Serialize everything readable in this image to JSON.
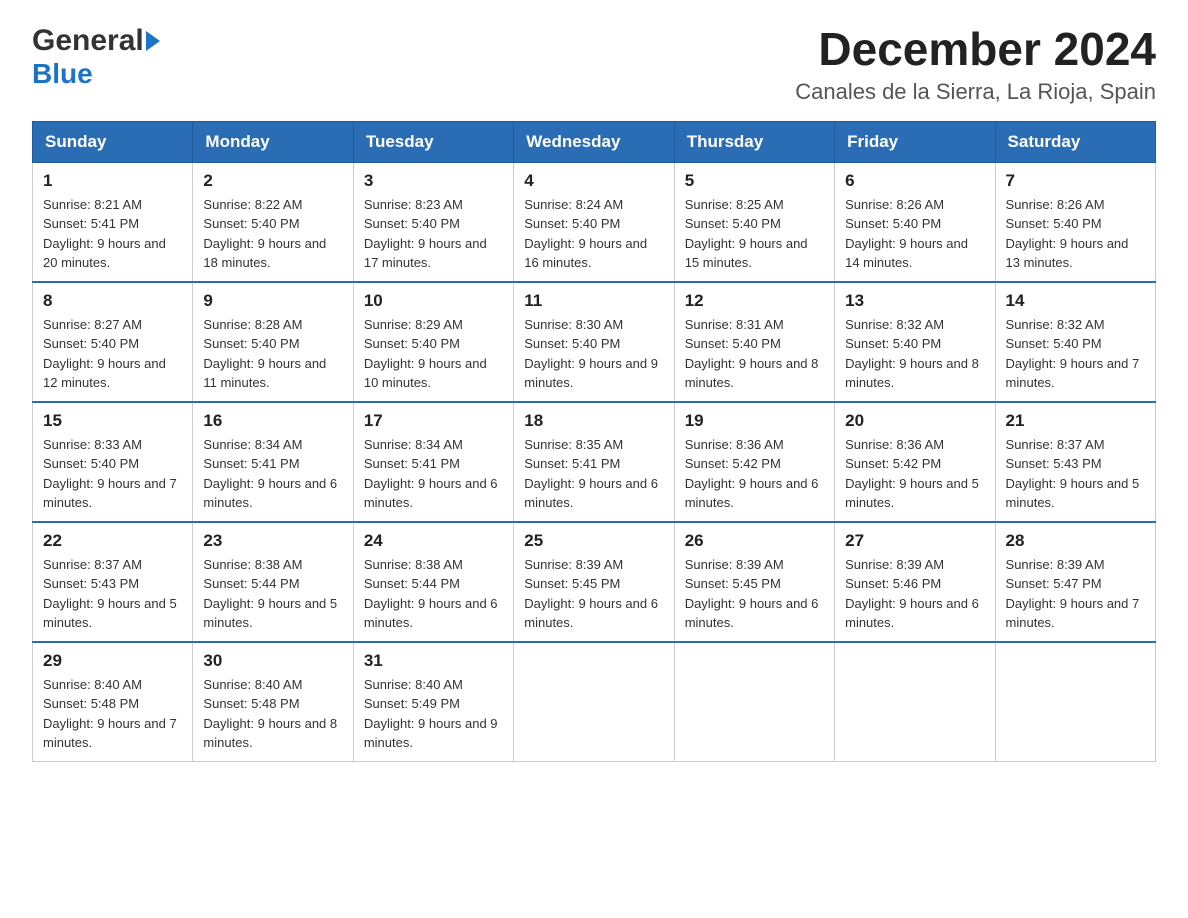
{
  "header": {
    "title": "December 2024",
    "subtitle": "Canales de la Sierra, La Rioja, Spain",
    "logo_general": "General",
    "logo_blue": "Blue"
  },
  "columns": [
    "Sunday",
    "Monday",
    "Tuesday",
    "Wednesday",
    "Thursday",
    "Friday",
    "Saturday"
  ],
  "weeks": [
    [
      {
        "day": "1",
        "sunrise": "8:21 AM",
        "sunset": "5:41 PM",
        "daylight": "9 hours and 20 minutes."
      },
      {
        "day": "2",
        "sunrise": "8:22 AM",
        "sunset": "5:40 PM",
        "daylight": "9 hours and 18 minutes."
      },
      {
        "day": "3",
        "sunrise": "8:23 AM",
        "sunset": "5:40 PM",
        "daylight": "9 hours and 17 minutes."
      },
      {
        "day": "4",
        "sunrise": "8:24 AM",
        "sunset": "5:40 PM",
        "daylight": "9 hours and 16 minutes."
      },
      {
        "day": "5",
        "sunrise": "8:25 AM",
        "sunset": "5:40 PM",
        "daylight": "9 hours and 15 minutes."
      },
      {
        "day": "6",
        "sunrise": "8:26 AM",
        "sunset": "5:40 PM",
        "daylight": "9 hours and 14 minutes."
      },
      {
        "day": "7",
        "sunrise": "8:26 AM",
        "sunset": "5:40 PM",
        "daylight": "9 hours and 13 minutes."
      }
    ],
    [
      {
        "day": "8",
        "sunrise": "8:27 AM",
        "sunset": "5:40 PM",
        "daylight": "9 hours and 12 minutes."
      },
      {
        "day": "9",
        "sunrise": "8:28 AM",
        "sunset": "5:40 PM",
        "daylight": "9 hours and 11 minutes."
      },
      {
        "day": "10",
        "sunrise": "8:29 AM",
        "sunset": "5:40 PM",
        "daylight": "9 hours and 10 minutes."
      },
      {
        "day": "11",
        "sunrise": "8:30 AM",
        "sunset": "5:40 PM",
        "daylight": "9 hours and 9 minutes."
      },
      {
        "day": "12",
        "sunrise": "8:31 AM",
        "sunset": "5:40 PM",
        "daylight": "9 hours and 8 minutes."
      },
      {
        "day": "13",
        "sunrise": "8:32 AM",
        "sunset": "5:40 PM",
        "daylight": "9 hours and 8 minutes."
      },
      {
        "day": "14",
        "sunrise": "8:32 AM",
        "sunset": "5:40 PM",
        "daylight": "9 hours and 7 minutes."
      }
    ],
    [
      {
        "day": "15",
        "sunrise": "8:33 AM",
        "sunset": "5:40 PM",
        "daylight": "9 hours and 7 minutes."
      },
      {
        "day": "16",
        "sunrise": "8:34 AM",
        "sunset": "5:41 PM",
        "daylight": "9 hours and 6 minutes."
      },
      {
        "day": "17",
        "sunrise": "8:34 AM",
        "sunset": "5:41 PM",
        "daylight": "9 hours and 6 minutes."
      },
      {
        "day": "18",
        "sunrise": "8:35 AM",
        "sunset": "5:41 PM",
        "daylight": "9 hours and 6 minutes."
      },
      {
        "day": "19",
        "sunrise": "8:36 AM",
        "sunset": "5:42 PM",
        "daylight": "9 hours and 6 minutes."
      },
      {
        "day": "20",
        "sunrise": "8:36 AM",
        "sunset": "5:42 PM",
        "daylight": "9 hours and 5 minutes."
      },
      {
        "day": "21",
        "sunrise": "8:37 AM",
        "sunset": "5:43 PM",
        "daylight": "9 hours and 5 minutes."
      }
    ],
    [
      {
        "day": "22",
        "sunrise": "8:37 AM",
        "sunset": "5:43 PM",
        "daylight": "9 hours and 5 minutes."
      },
      {
        "day": "23",
        "sunrise": "8:38 AM",
        "sunset": "5:44 PM",
        "daylight": "9 hours and 5 minutes."
      },
      {
        "day": "24",
        "sunrise": "8:38 AM",
        "sunset": "5:44 PM",
        "daylight": "9 hours and 6 minutes."
      },
      {
        "day": "25",
        "sunrise": "8:39 AM",
        "sunset": "5:45 PM",
        "daylight": "9 hours and 6 minutes."
      },
      {
        "day": "26",
        "sunrise": "8:39 AM",
        "sunset": "5:45 PM",
        "daylight": "9 hours and 6 minutes."
      },
      {
        "day": "27",
        "sunrise": "8:39 AM",
        "sunset": "5:46 PM",
        "daylight": "9 hours and 6 minutes."
      },
      {
        "day": "28",
        "sunrise": "8:39 AM",
        "sunset": "5:47 PM",
        "daylight": "9 hours and 7 minutes."
      }
    ],
    [
      {
        "day": "29",
        "sunrise": "8:40 AM",
        "sunset": "5:48 PM",
        "daylight": "9 hours and 7 minutes."
      },
      {
        "day": "30",
        "sunrise": "8:40 AM",
        "sunset": "5:48 PM",
        "daylight": "9 hours and 8 minutes."
      },
      {
        "day": "31",
        "sunrise": "8:40 AM",
        "sunset": "5:49 PM",
        "daylight": "9 hours and 9 minutes."
      },
      null,
      null,
      null,
      null
    ]
  ]
}
